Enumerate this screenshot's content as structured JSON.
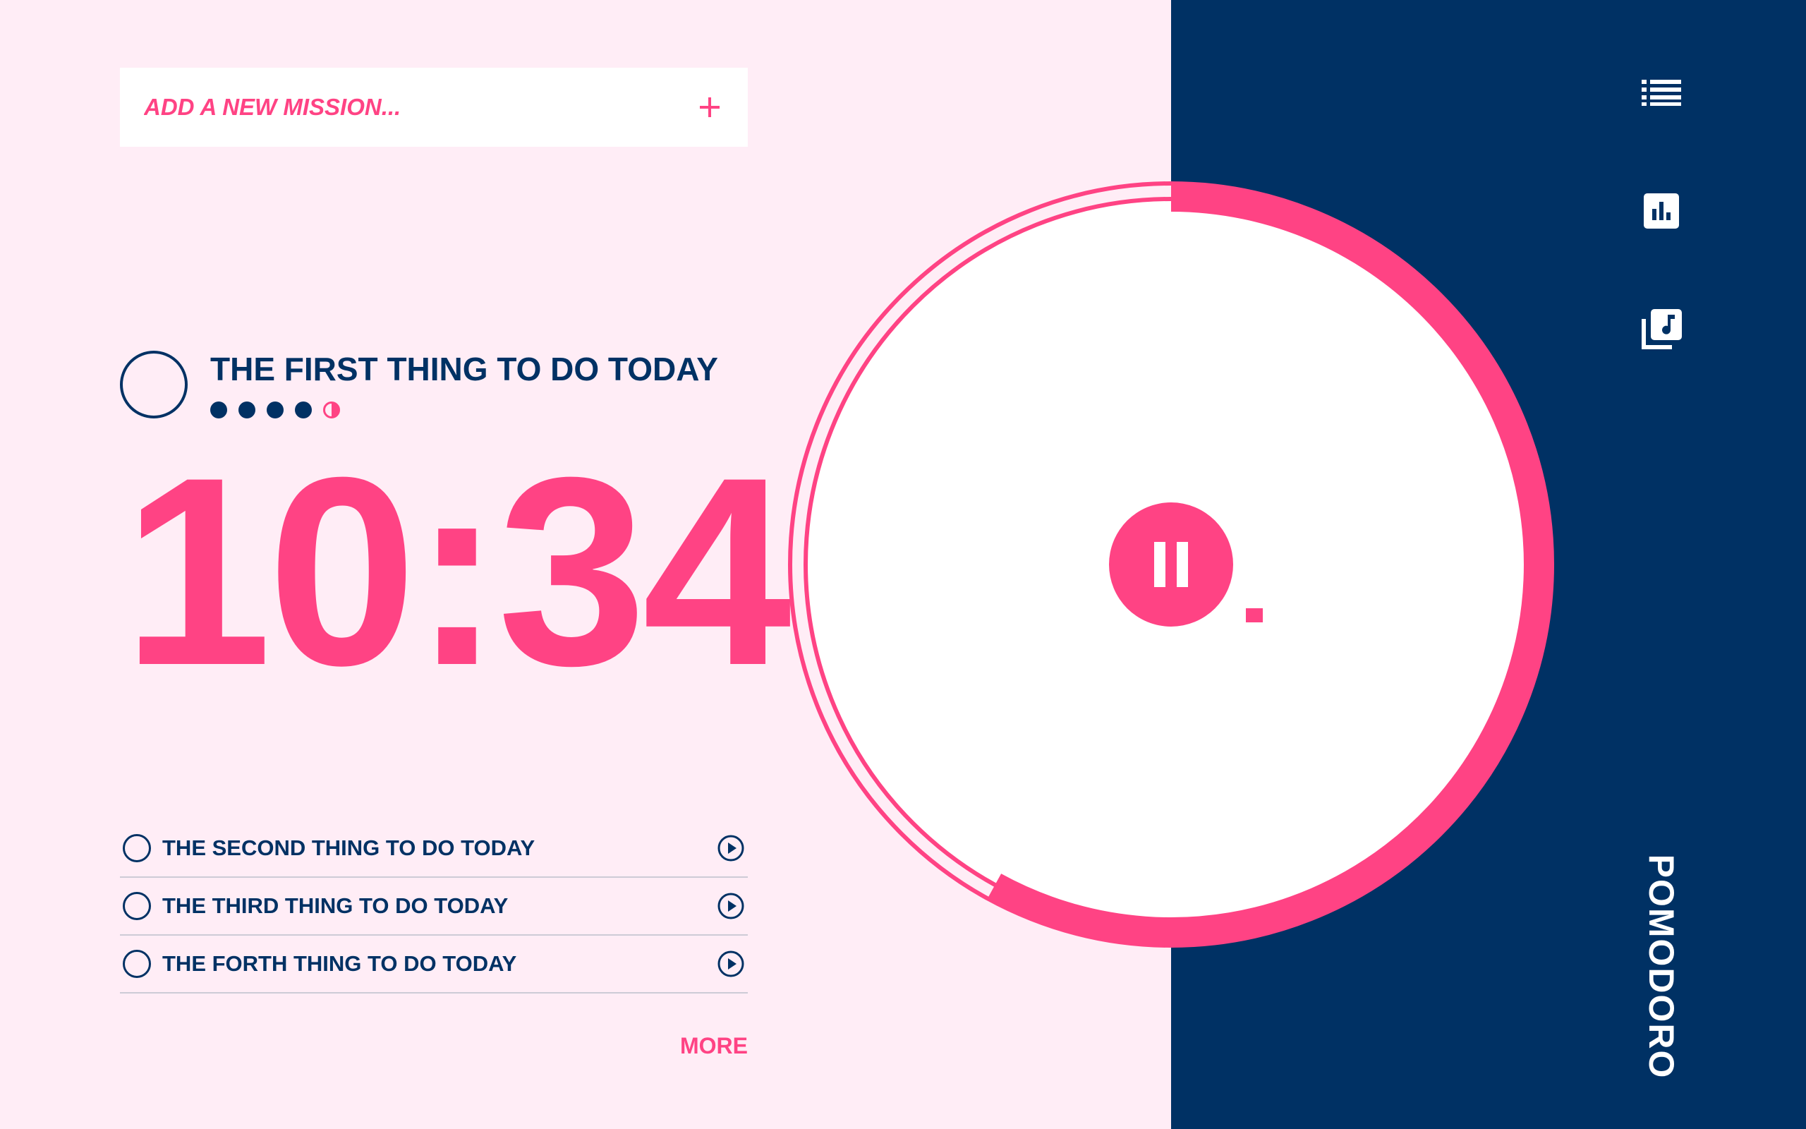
{
  "add_mission": {
    "placeholder": "ADD A NEW MISSION..."
  },
  "current_task": {
    "title": "THE FIRST THING TO DO TODAY",
    "pomodoros_completed": 4,
    "pomodoro_in_progress": 1
  },
  "timer": {
    "display": "10:34",
    "progress_fraction": 0.58
  },
  "tasks": [
    {
      "label": "THE SECOND THING TO DO TODAY"
    },
    {
      "label": "THE THIRD THING TO DO TODAY"
    },
    {
      "label": "THE FORTH THING TO DO TODAY"
    }
  ],
  "more_label": "MORE",
  "brand": "POMODORO",
  "sidebar": {
    "icons": [
      "list-icon",
      "bar-chart-icon",
      "music-library-icon"
    ]
  },
  "colors": {
    "accent": "#FF4384",
    "navy": "#003164",
    "background": "#FFEDF6",
    "white": "#FFFFFF"
  }
}
